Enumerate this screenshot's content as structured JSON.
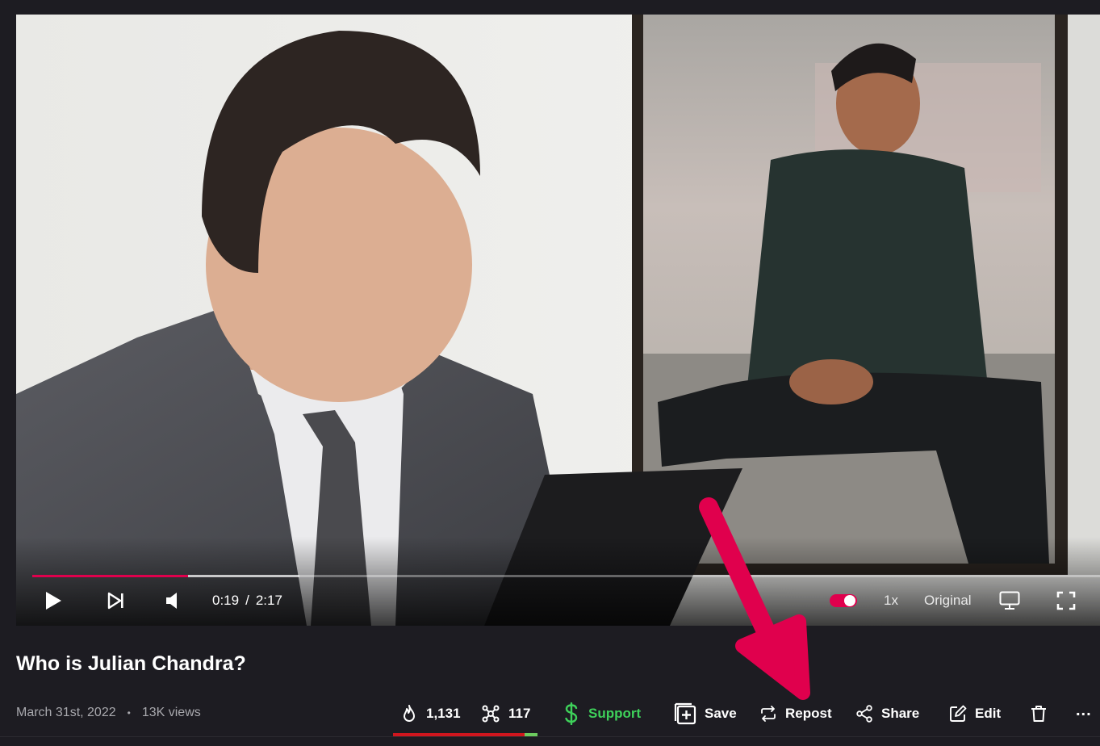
{
  "video": {
    "current_time": "0:19",
    "time_separator": "/",
    "duration": "2:17",
    "played_fraction": 0.146,
    "buffered_fraction": 0.25,
    "autoplay_on": true,
    "speed_label": "1x",
    "quality_label": "Original"
  },
  "title": "Who is Julian Chandra?",
  "meta": {
    "date": "March 31st, 2022",
    "separator": "•",
    "views": "13K views"
  },
  "actions": {
    "fire_count": "1,131",
    "slime_count": "117",
    "support_label": "Support",
    "save_label": "Save",
    "repost_label": "Repost",
    "share_label": "Share",
    "edit_label": "Edit",
    "more_label": "..."
  },
  "colors": {
    "accent": "#e0004d",
    "support": "#3ed15a",
    "dislike_bar": "#d0161e",
    "like_bar": "#6ccb5f",
    "background": "#1d1c22"
  },
  "icons": [
    "play-icon",
    "skip-next-icon",
    "volume-icon",
    "cast-icon",
    "fullscreen-icon",
    "fire-icon",
    "slime-icon",
    "dollar-icon",
    "save-icon",
    "repost-icon",
    "share-icon",
    "edit-icon",
    "trash-icon",
    "more-icon"
  ]
}
